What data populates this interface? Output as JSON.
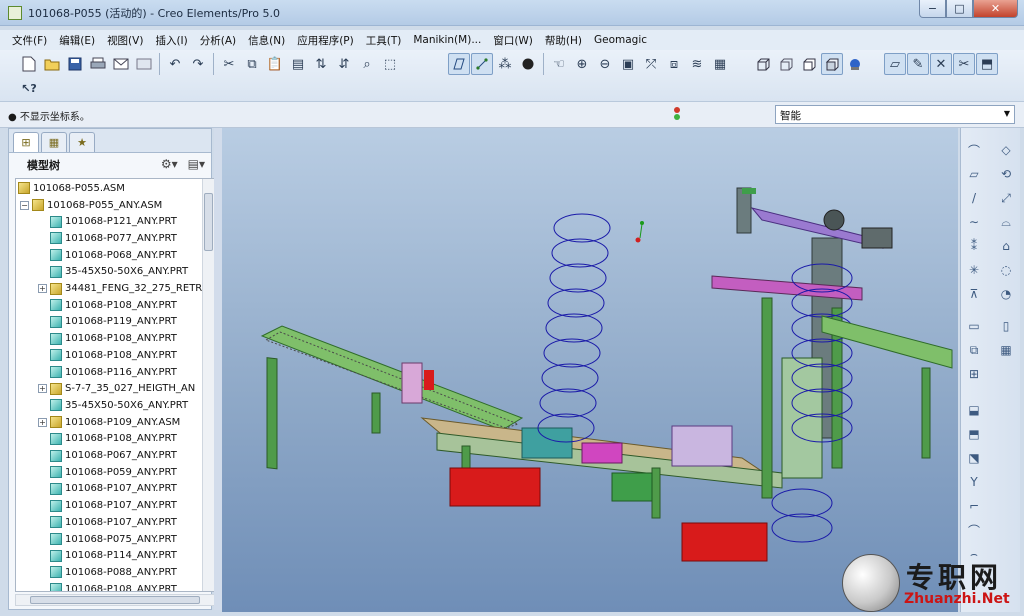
{
  "window": {
    "title": "101068-P055 (活动的) - Creo Elements/Pro 5.0",
    "min_label": "−",
    "max_label": "□",
    "close_label": "✕"
  },
  "menubar": {
    "items": [
      "文件(F)",
      "编辑(E)",
      "视图(V)",
      "插入(I)",
      "分析(A)",
      "信息(N)",
      "应用程序(P)",
      "工具(T)",
      "Manikin(M)...",
      "窗口(W)",
      "帮助(H)",
      "Geomagic"
    ]
  },
  "message": {
    "text": "● 不显示坐标系。"
  },
  "filter": {
    "value": "智能"
  },
  "navigator": {
    "title": "模型树",
    "tabs": [
      "model-tree",
      "folder-browser",
      "favorites"
    ]
  },
  "model_tree": {
    "items": [
      {
        "label": "101068-P055.ASM",
        "type": "asm",
        "level": 0,
        "expander": ""
      },
      {
        "label": "101068-P055_ANY.ASM",
        "type": "asm",
        "level": 1,
        "expander": "−"
      },
      {
        "label": "101068-P121_ANY.PRT",
        "type": "prt",
        "level": 2,
        "expander": ""
      },
      {
        "label": "101068-P077_ANY.PRT",
        "type": "prt",
        "level": 2,
        "expander": ""
      },
      {
        "label": "101068-P068_ANY.PRT",
        "type": "prt",
        "level": 2,
        "expander": ""
      },
      {
        "label": "35-45X50-50X6_ANY.PRT",
        "type": "prt",
        "level": 2,
        "expander": ""
      },
      {
        "label": "34481_FENG_32_275_RETR",
        "type": "asm",
        "level": 2,
        "expander": "+"
      },
      {
        "label": "101068-P108_ANY.PRT",
        "type": "prt",
        "level": 2,
        "expander": ""
      },
      {
        "label": "101068-P119_ANY.PRT",
        "type": "prt",
        "level": 2,
        "expander": ""
      },
      {
        "label": "101068-P108_ANY.PRT",
        "type": "prt",
        "level": 2,
        "expander": ""
      },
      {
        "label": "101068-P108_ANY.PRT",
        "type": "prt",
        "level": 2,
        "expander": ""
      },
      {
        "label": "101068-P116_ANY.PRT",
        "type": "prt",
        "level": 2,
        "expander": ""
      },
      {
        "label": "S-7-7_35_027_HEIGTH_AN",
        "type": "asm",
        "level": 2,
        "expander": "+"
      },
      {
        "label": "35-45X50-50X6_ANY.PRT",
        "type": "prt",
        "level": 2,
        "expander": ""
      },
      {
        "label": "101068-P109_ANY.ASM",
        "type": "asm",
        "level": 2,
        "expander": "+"
      },
      {
        "label": "101068-P108_ANY.PRT",
        "type": "prt",
        "level": 2,
        "expander": ""
      },
      {
        "label": "101068-P067_ANY.PRT",
        "type": "prt",
        "level": 2,
        "expander": ""
      },
      {
        "label": "101068-P059_ANY.PRT",
        "type": "prt",
        "level": 2,
        "expander": ""
      },
      {
        "label": "101068-P107_ANY.PRT",
        "type": "prt",
        "level": 2,
        "expander": ""
      },
      {
        "label": "101068-P107_ANY.PRT",
        "type": "prt",
        "level": 2,
        "expander": ""
      },
      {
        "label": "101068-P107_ANY.PRT",
        "type": "prt",
        "level": 2,
        "expander": ""
      },
      {
        "label": "101068-P075_ANY.PRT",
        "type": "prt",
        "level": 2,
        "expander": ""
      },
      {
        "label": "101068-P114_ANY.PRT",
        "type": "prt",
        "level": 2,
        "expander": ""
      },
      {
        "label": "101068-P088_ANY.PRT",
        "type": "prt",
        "level": 2,
        "expander": ""
      },
      {
        "label": "101068-P108_ANY.PRT",
        "type": "prt",
        "level": 2,
        "expander": ""
      }
    ]
  },
  "toolbar": {
    "row1_icons": [
      "new-file-icon",
      "open-folder-icon",
      "save-icon",
      "print-icon",
      "email-icon",
      "email-link-icon",
      "undo-icon",
      "redo-icon",
      "cut-icon",
      "copy-icon",
      "paste-icon",
      "paste-special-icon",
      "regenerate-icon",
      "regenerate-manager-icon",
      "find-icon",
      "select-box-icon",
      "datum-plane-display-icon",
      "datum-axis-display-icon",
      "point-display-icon",
      "csys-display-icon",
      "spin-center-icon",
      "orient-mode-icon",
      "zoom-in-icon",
      "zoom-out-icon",
      "refit-icon",
      "reorient-icon",
      "saved-views-icon",
      "layers-icon",
      "view-manager-icon",
      "wireframe-icon",
      "hidden-line-icon",
      "no-hidden-icon",
      "shading-icon",
      "enhanced-realism-icon",
      "sketch-icon",
      "annotation-icon",
      "tolerance-icon",
      "trim-icon",
      "datum-icon"
    ],
    "row2_icons": [
      "context-help-icon"
    ]
  },
  "watermark": {
    "cn": "专职网",
    "url": "Zhuanzhi.Net"
  },
  "colors": {
    "viewport_top": "#b9cde3",
    "viewport_bottom": "#6f8eb7",
    "spring": "#1a1aa8",
    "frame_green": "#3f9e4a",
    "block_red": "#d81b1b",
    "arm_purple": "#9a7ad0"
  }
}
